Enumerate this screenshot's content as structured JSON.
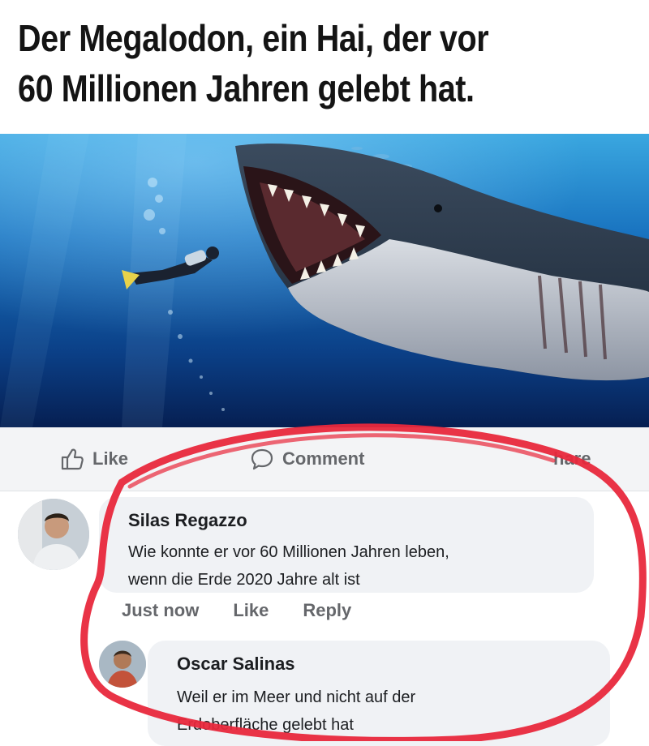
{
  "meme": {
    "title_line1": "Der Megalodon, ein Hai, der vor",
    "title_line2": "60 Millionen Jahren gelebt hat."
  },
  "actions": {
    "like": "Like",
    "comment": "Comment",
    "share": "hare"
  },
  "comments": [
    {
      "author": "Silas Regazzo",
      "text_line1": "Wie konnte er vor 60 Millionen Jahren leben,",
      "text_line2": "wenn die Erde 2020 Jahre alt ist",
      "time": "Just now",
      "like": "Like",
      "reply": "Reply"
    },
    {
      "author": "Oscar Salinas",
      "text_line1": "Weil er im Meer und nicht auf der",
      "text_line2": "Erdoberfläche gelebt hat"
    }
  ],
  "colors": {
    "highlight": "#e8283c",
    "ocean_light": "#2f9fd8",
    "ocean_dark": "#06245a",
    "meta_gray": "#65676b"
  }
}
